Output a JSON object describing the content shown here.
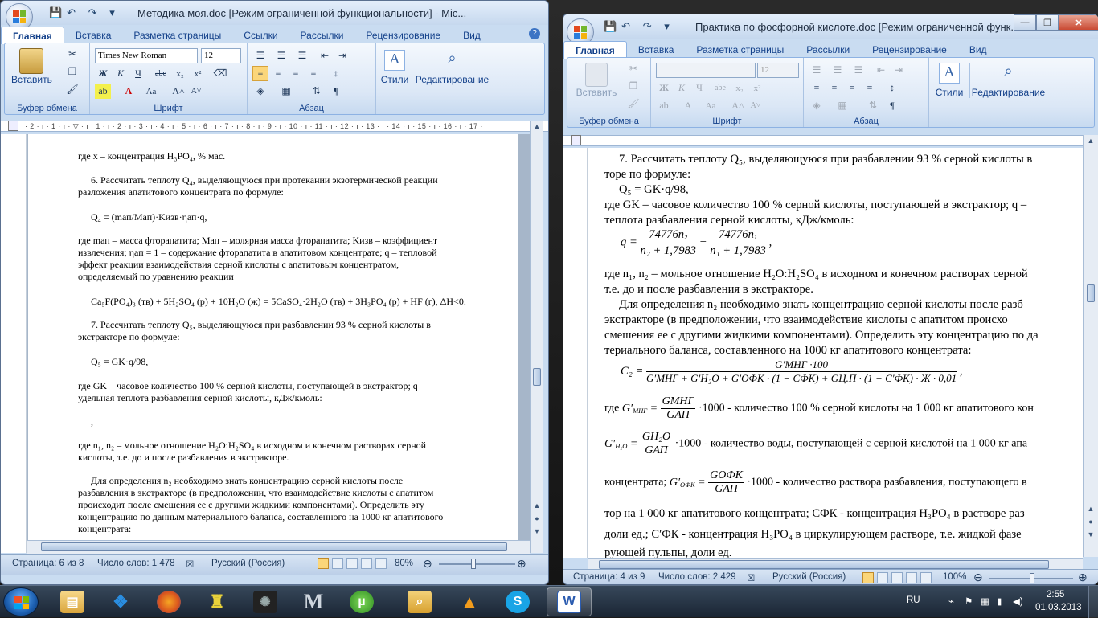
{
  "win1": {
    "title": "Методика моя.doc [Режим ограниченной функциональности] - Mic...",
    "tabs": [
      "Главная",
      "Вставка",
      "Разметка страницы",
      "Ссылки",
      "Рассылки",
      "Рецензирование",
      "Вид"
    ],
    "font_name": "Times New Roman",
    "font_size": "12",
    "paste": "Вставить",
    "groups": {
      "clipboard": "Буфер обмена",
      "font": "Шрифт",
      "paragraph": "Абзац"
    },
    "styles": "Стили",
    "editing": "Редактирование",
    "ruler": "· 2 · ı · 1 · ı · ▽ · ı · 1 · ı · 2 · ı · 3 · ı · 4 · ı · 5 · ı · 6 · ı · 7 · ı · 8 · ı · 9 · ı · 10 · ı · 11 · ı · 12 · ı · 13 · ı · 14 · ı · 15 · ı · 16 · ı · 17 ·",
    "status": {
      "page": "Страница: 6 из 8",
      "words": "Число слов: 1 478",
      "lang": "Русский (Россия)",
      "zoom": "80%"
    },
    "doc": {
      "l1": "где x – концентрация H₃PO₄, % мас.",
      "l2": "6. Рассчитать теплоту Q₄, выделяющуюся при протекании экзотермической реакции",
      "l3": "разложения апатитового концентрата по формуле:",
      "l4": "Q₄ = (mап/Mап)·Kизв·ηап·q,",
      "l5": "где mап – масса фторапатита; Mап – молярная масса фторапатита; Kизв – коэффициент",
      "l6": "извлечения; ηап = 1 – содержание фторапатита в апатитовом концентрате; q –  тепловой",
      "l7": "эффект реакции взаимодействия серной кислоты с апатитовым концентратом,",
      "l8": "определяемый по уравнению реакции",
      "l9": "Ca₅F(PO₄)₃ (тв) + 5H₂SO₄ (р) + 10H₂O (ж) = 5CaSO₄·2H₂O (тв) + 3H₃PO₄ (р) + HF (г), ΔH<0.",
      "l10": "7. Рассчитать теплоту Q₅, выделяющуюся при разбавлении 93 % серной кислоты в",
      "l11": "экстракторе по формуле:",
      "l12": "Q₅ = GK·q/98,",
      "l13": "где GK – часовое количество 100 % серной кислоты, поступающей в экстрактор; q –",
      "l14": "удельная теплота разбавления серной кислоты, кДж/кмоль:",
      "l15": ",",
      "l16": "где n₁, n₂ – мольное отношение H₂O:H₂SO₄ в исходном и конечном растворах серной",
      "l17": "кислоты, т.е. до и после разбавления в экстракторе.",
      "l18": "Для определения n₂ необходимо знать концентрацию серной кислоты после",
      "l19": "разбавления в экстракторе (в предположении, что взаимодействие кислоты с апатитом",
      "l20": "происходит после смешения ее с другими жидкими компонентами). Определить эту",
      "l21": "концентрацию по данным материального баланса, составленного на 1000 кг апатитового",
      "l22": "концентрата:"
    }
  },
  "win2": {
    "title": "Практика по фосфорной кислоте.doc [Режим ограниченной функ...",
    "tabs": [
      "Главная",
      "Вставка",
      "Разметка страницы",
      "Рассылки",
      "Рецензирование",
      "Вид"
    ],
    "font_size": "12",
    "paste": "Вставить",
    "groups": {
      "clipboard": "Буфер обмена",
      "font": "Шрифт",
      "paragraph": "Абзац"
    },
    "styles": "Стили",
    "editing": "Редактирование",
    "status": {
      "page": "Страница: 4 из 9",
      "words": "Число слов: 2 429",
      "lang": "Русский (Россия)",
      "zoom": "100%"
    },
    "doc": {
      "l1": "7. Рассчитать теплоту Q₅, выделяющуюся при разбавлении 93 % серной кислоты в",
      "l2": "торе по формуле:",
      "l3": "Q₅ = GK·q/98,",
      "l4": "где GK – часовое количество 100 % серной кислоты, поступающей в экстрактор; q –",
      "l5": "теплота разбавления серной кислоты, кДж/кмоль:",
      "f_q": "q =",
      "f_num": "74776n",
      "f_den1": "n₂ + 1,7983",
      "f_den2": "n₁ + 1,7983",
      "l6": "где n₁, n₂ – мольное отношение H₂O:H₂SO₄ в исходном и конечном растворах серной",
      "l7": "т.е. до и после разбавления в экстракторе.",
      "l8": "Для определения n₂ необходимо знать концентрацию серной кислоты после разб",
      "l9": "экстракторе (в предположении, что взаимодействие кислоты с апатитом происхо",
      "l10": "смешения ее с другими жидкими компонентами). Определить эту концентрацию по да",
      "l11": "териального баланса, составленного на 1000 кг апатитового концентрата:",
      "c2_lhs": "C₂ =",
      "c2_num": "G′МНГ ·100",
      "c2_den": "G′МНГ + G′H₂O + G′OФК · (1 − CФК) + GЦ.П · (1 − C′ФК) · Ж · 0,01",
      "l12a": "где",
      "l12_num": "GМНГ",
      "l12_den": "GАП",
      "l12b": "·1000  - количество 100 % серной кислоты на 1 000 кг апатитового кон",
      "l13_num": "GH₂O",
      "l13_den": "GАП",
      "l13b": "·1000  - количество воды, поступающей с серной кислотой на 1 000 кг апа",
      "l14a": "концентрата;",
      "l14_num": "GOФК",
      "l14_den": "GАП",
      "l14b": "·1000  - количество раствора разбавления, поступающего в",
      "l15": "тор на 1 000 кг апатитового концентрата;  CФК  - концентрация H₃PO₄ в растворе раз",
      "l16": "доли ед.;  C′ФК  - концентрация H₃PO₄ в циркулирующем растворе, т.е. жидкой фазе",
      "l17": "рующей пульпы, доли ед."
    }
  },
  "taskbar": {
    "lang": "RU",
    "time": "2:55",
    "date": "01.03.2013",
    "apps": [
      "windows-explorer",
      "dropbox",
      "firefox",
      "app-yellow",
      "app-fan",
      "app-m",
      "utorrent",
      "app-search",
      "vlc",
      "skype",
      "word"
    ]
  }
}
